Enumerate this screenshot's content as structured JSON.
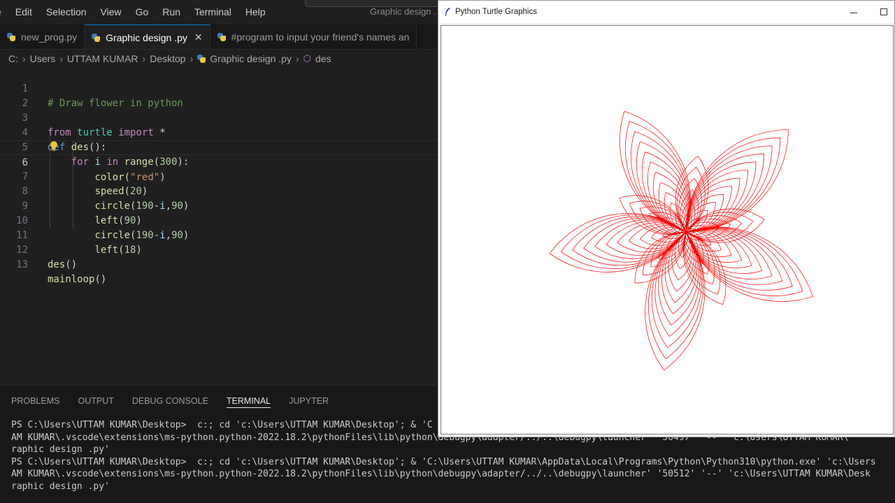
{
  "menubar": {
    "items": [
      "e",
      "Edit",
      "Selection",
      "View",
      "Go",
      "Run",
      "Terminal",
      "Help"
    ],
    "window_title": "Graphic design ."
  },
  "tabs": [
    {
      "label": "new_prog.py",
      "active": false
    },
    {
      "label": "Graphic design .py",
      "active": true
    },
    {
      "label": "#program to input your friend's names an",
      "active": false
    }
  ],
  "breadcrumb": [
    "C:",
    "Users",
    "UTTAM KUMAR",
    "Desktop",
    "Graphic design .py",
    "des"
  ],
  "editor": {
    "current_line": 6,
    "line_numbers": [
      "1",
      "2",
      "3",
      "4",
      "5",
      "6",
      "7",
      "8",
      "9",
      "10",
      "11",
      "12",
      "13"
    ],
    "lines": [
      "# Draw flower in python",
      "",
      "from turtle import *",
      "def des():",
      "    for i in range(300):",
      "        color(\"red\")",
      "        speed(20)",
      "        circle(190-i,90)",
      "        left(90)",
      "        circle(190-i,90)",
      "        left(18)",
      "des()",
      "mainloop()"
    ]
  },
  "panel": {
    "tabs": [
      {
        "label": "PROBLEMS",
        "active": false
      },
      {
        "label": "OUTPUT",
        "active": false
      },
      {
        "label": "DEBUG CONSOLE",
        "active": false
      },
      {
        "label": "TERMINAL",
        "active": true
      },
      {
        "label": "JUPYTER",
        "active": false
      }
    ],
    "terminal_lines": [
      "PS C:\\Users\\UTTAM KUMAR\\Desktop>  c:; cd 'c:\\Users\\UTTAM KUMAR\\Desktop'; & 'C",
      "AM KUMAR\\.vscode\\extensions\\ms-python.python-2022.18.2\\pythonFiles\\lib\\python\\debugpy\\adapter/../..\\debugpy\\launcher' '50497' '--' 'c:\\Users\\UTTAM KUMAR\\",
      "raphic design .py'",
      "PS C:\\Users\\UTTAM KUMAR\\Desktop>  c:; cd 'c:\\Users\\UTTAM KUMAR\\Desktop'; & 'C:\\Users\\UTTAM KUMAR\\AppData\\Local\\Programs\\Python\\Python310\\python.exe' 'c:\\Users",
      "AM KUMAR\\.vscode\\extensions\\ms-python.python-2022.18.2\\pythonFiles\\lib\\python\\debugpy\\adapter/../..\\debugpy\\launcher' '50512' '--' 'c:\\Users\\UTTAM KUMAR\\Desk",
      "raphic design .py'"
    ]
  },
  "turtle_window": {
    "title": "Python Turtle Graphics",
    "pen_color": "#ff0000",
    "petals": 5
  },
  "colors": {
    "editor_bg": "#1f1f1f",
    "accent": "#0078d4",
    "keyword": "#c586c0",
    "function": "#dcdcaa",
    "string": "#ce9178",
    "number": "#b5cea8"
  }
}
